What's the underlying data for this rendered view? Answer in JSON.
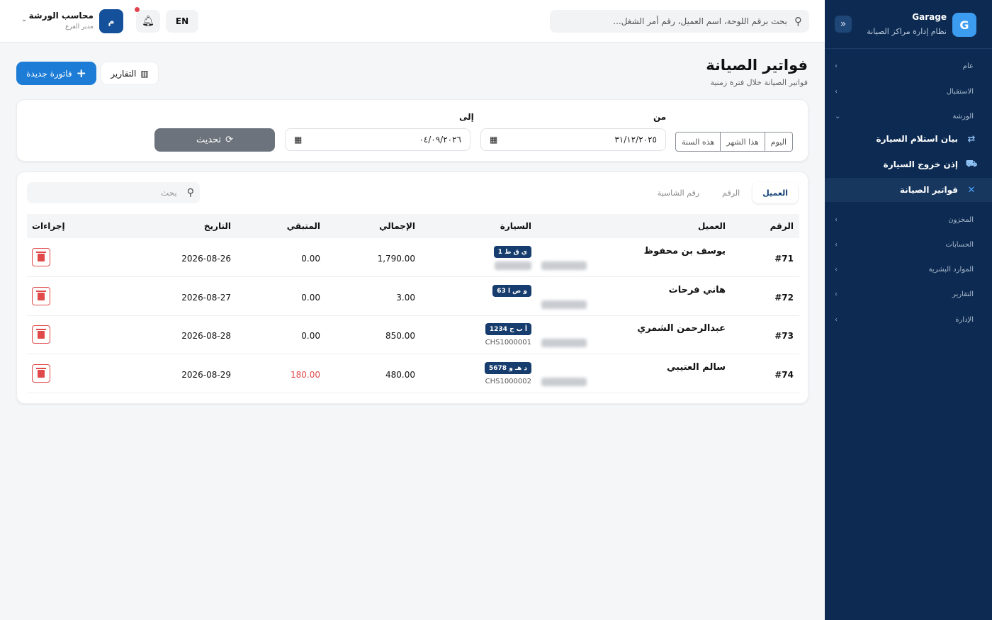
{
  "sidebar": {
    "brand_logo": "G",
    "brand_name": "Garage",
    "brand_subtitle": "نظام إدارة مراكز الصيانة",
    "sections": {
      "general": "عام",
      "reception": "الاستقبال",
      "workshop": "الورشة",
      "inventory": "المخزون",
      "accounts": "الحسابات",
      "hr": "الموارد البشرية",
      "reports": "التقارير",
      "admin": "الإدارة"
    },
    "workshop_items": [
      {
        "label": "بيان استلام السيارة",
        "icon": "exchange-icon"
      },
      {
        "label": "إذن خروج السيارة",
        "icon": "car-icon"
      },
      {
        "label": "فواتير الصيانة",
        "icon": "tools-icon"
      }
    ]
  },
  "header": {
    "search_placeholder": "بحث برقم اللوحة، اسم العميل، رقم أمر الشغل...",
    "language": "EN",
    "user_initial": "م",
    "user_name": "محاسب الورشة",
    "user_role": "مدير الفرع"
  },
  "page": {
    "title": "فواتير الصيانة",
    "subtitle": "فواتير الصيانة خلال فترة زمنية",
    "new_invoice": "فاتورة جديدة",
    "reports": "التقارير"
  },
  "filters": {
    "range_today": "اليوم",
    "range_month": "هذا الشهر",
    "range_year": "هذه السنة",
    "from_label": "من",
    "to_label": "إلى",
    "from_value": "٣١/١٢/٢٠٢٥",
    "to_value": "٠٤/٠٩/٢٠٢٦",
    "refresh": "تحديث"
  },
  "search_tabs": [
    "العميل",
    "الرقم",
    "رقم الشاسية"
  ],
  "table_search_placeholder": "بحث",
  "table": {
    "columns": {
      "number": "الرقم",
      "client": "العميل",
      "car": "السيارة",
      "total": "الإجمالي",
      "remaining": "المتبقي",
      "date": "التاريخ",
      "actions": "إجراءات"
    },
    "rows": [
      {
        "number": "#71",
        "client": "يوسف بن محفوظ",
        "plate": "ي ق ط 1",
        "chassis": "",
        "total": "1,790.00",
        "remaining": "0.00",
        "date": "2026-08-26"
      },
      {
        "number": "#72",
        "client": "هاني فرحات",
        "plate": "و ص ا 63",
        "chassis": "",
        "total": "3.00",
        "remaining": "0.00",
        "date": "2026-08-27"
      },
      {
        "number": "#73",
        "client": "عبدالرحمن الشمري",
        "plate": "أ ب ح 1234",
        "chassis": "CHS1000001",
        "total": "850.00",
        "remaining": "0.00",
        "date": "2026-08-28"
      },
      {
        "number": "#74",
        "client": "سالم العتيبي",
        "plate": "د هـ و 5678",
        "chassis": "CHS1000002",
        "total": "480.00",
        "remaining": "180.00",
        "date": "2026-08-29"
      }
    ]
  },
  "colors": {
    "sidebar_bg": "#0d2b52",
    "primary": "#1c7cd6",
    "danger": "#e04a4a",
    "plate_bg": "#173d6e"
  }
}
